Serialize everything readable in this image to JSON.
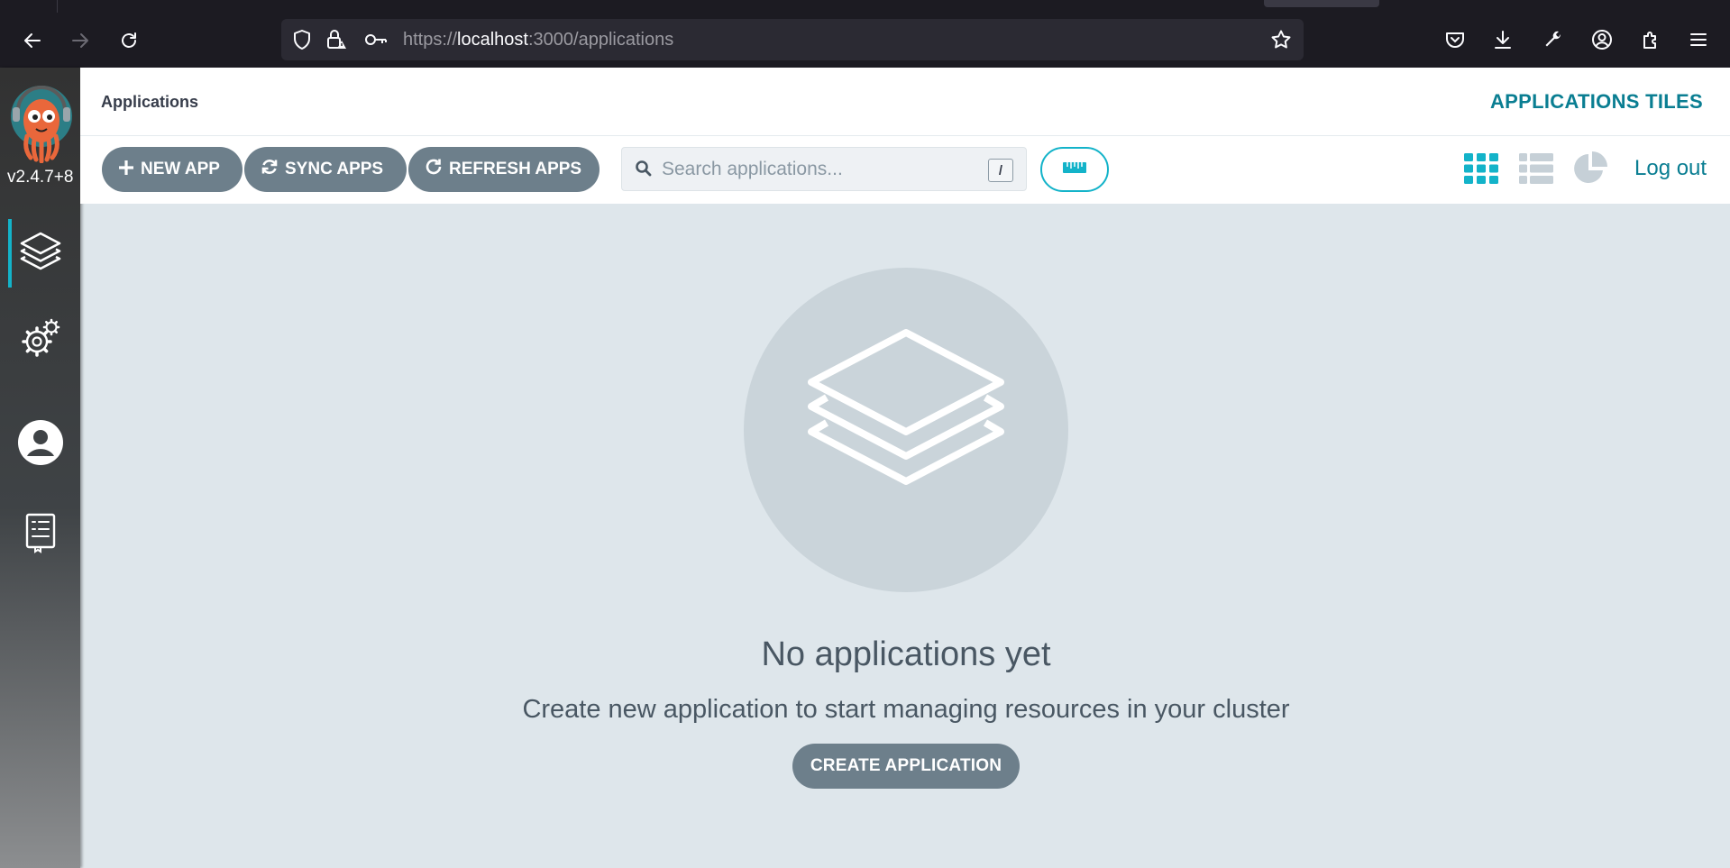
{
  "browser": {
    "url_scheme": "https://",
    "url_host": "localhost",
    "url_path": ":3000/applications"
  },
  "sidebar": {
    "version": "v2.4.7+8",
    "items": [
      {
        "name": "applications",
        "icon": "layers-icon",
        "active": true
      },
      {
        "name": "settings",
        "icon": "gears-icon",
        "active": false
      },
      {
        "name": "user-info",
        "icon": "user-icon",
        "active": false
      },
      {
        "name": "docs",
        "icon": "docs-icon",
        "active": false
      }
    ]
  },
  "header": {
    "title": "Applications",
    "view_title": "APPLICATIONS TILES"
  },
  "toolbar": {
    "new_app_label": "NEW APP",
    "sync_apps_label": "SYNC APPS",
    "refresh_apps_label": "REFRESH APPS",
    "search_placeholder": "Search applications...",
    "search_shortcut": "/",
    "logout_label": "Log out"
  },
  "empty_state": {
    "title": "No applications yet",
    "description": "Create new application to start managing resources in your cluster",
    "button_label": "CREATE APPLICATION"
  },
  "colors": {
    "accent": "#13b3c9",
    "brand_text": "#0a7e92",
    "button_gray": "#6d7f8b",
    "page_bg": "#dee6eb"
  }
}
